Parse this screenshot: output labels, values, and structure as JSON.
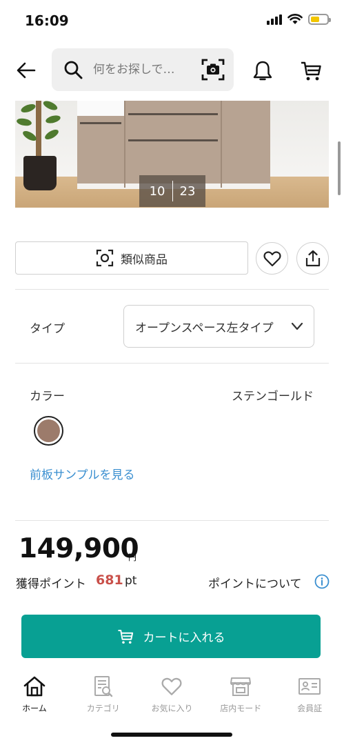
{
  "status_bar": {
    "time": "16:09",
    "battery_color": "#f2c500"
  },
  "header": {
    "search_placeholder": "何をお探しで…",
    "icons": [
      "back-arrow-icon",
      "search-icon",
      "camera-scan-icon",
      "bell-icon",
      "cart-icon"
    ]
  },
  "gallery": {
    "current": "10",
    "total": "23"
  },
  "actions": {
    "similar_label": "類似商品",
    "icons": [
      "scan-icon",
      "heart-icon",
      "share-icon"
    ]
  },
  "options": {
    "type_label": "タイプ",
    "type_value": "オープンスペース左タイプ",
    "color_label": "カラー",
    "color_value": "ステンゴールド",
    "swatch_color": "#9c7b6b",
    "sample_link": "前板サンプルを見る"
  },
  "pricing": {
    "price": "149,900",
    "price_unit": "円",
    "points_label": "獲得ポイント",
    "points_value": "681",
    "points_unit": "pt",
    "points_about": "ポイントについて"
  },
  "cart_button": {
    "label": "カートに入れる",
    "color": "#08a093"
  },
  "bottom_nav": {
    "items": [
      {
        "label": "ホーム",
        "icon": "home-icon",
        "active": true
      },
      {
        "label": "カテゴリ",
        "icon": "category-icon",
        "active": false
      },
      {
        "label": "お気に入り",
        "icon": "heart-icon",
        "active": false
      },
      {
        "label": "店内モード",
        "icon": "store-icon",
        "active": false
      },
      {
        "label": "会員証",
        "icon": "member-card-icon",
        "active": false
      }
    ]
  }
}
